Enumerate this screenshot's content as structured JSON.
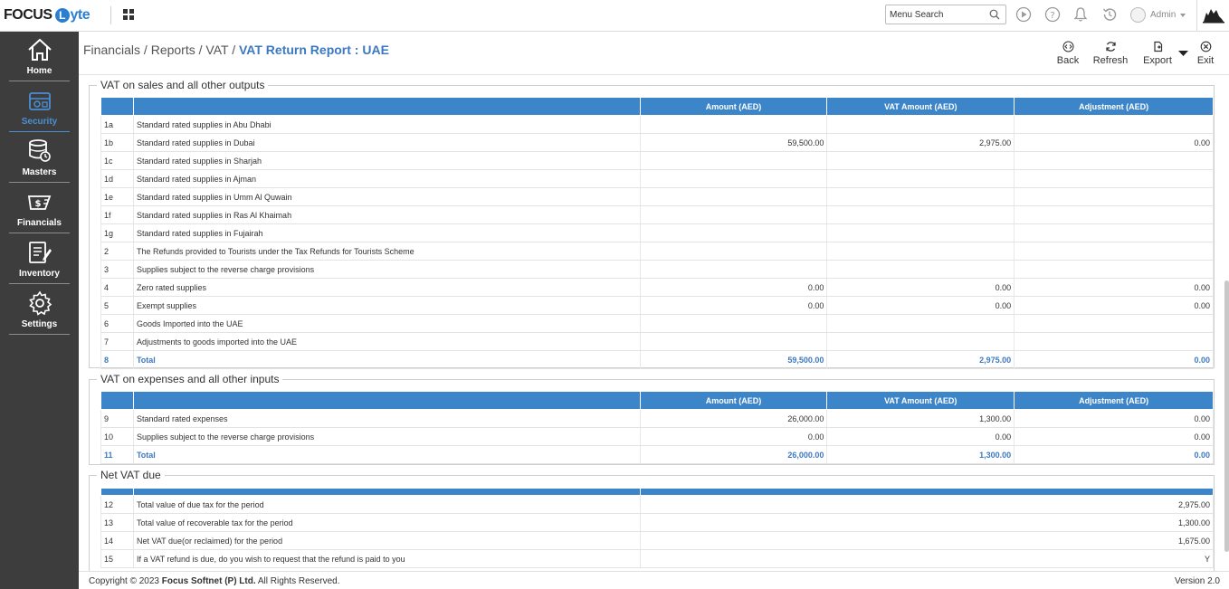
{
  "app": {
    "logo_main": "FOCUS",
    "logo_circle": "L",
    "logo_tail": "yte"
  },
  "topbar": {
    "search_placeholder": "Menu Search",
    "user": "Admin"
  },
  "sidebar": {
    "items": [
      {
        "label": "Home",
        "icon": "home-icon"
      },
      {
        "label": "Security",
        "icon": "security-icon"
      },
      {
        "label": "Masters",
        "icon": "masters-icon"
      },
      {
        "label": "Financials",
        "icon": "financials-icon"
      },
      {
        "label": "Inventory",
        "icon": "inventory-icon"
      },
      {
        "label": "Settings",
        "icon": "settings-icon"
      }
    ]
  },
  "breadcrumb": {
    "parts": [
      "Financials /",
      "Reports /",
      "VAT /"
    ],
    "current": "VAT Return Report : UAE"
  },
  "actions": {
    "back": "Back",
    "refresh": "Refresh",
    "export": "Export",
    "exit": "Exit"
  },
  "sales": {
    "title": "VAT on sales and all other outputs",
    "headers": [
      "",
      "",
      "Amount (AED)",
      "VAT Amount (AED)",
      "Adjustment (AED)"
    ],
    "rows": [
      [
        "1a",
        "Standard rated supplies in Abu Dhabi",
        "",
        "",
        ""
      ],
      [
        "1b",
        "Standard rated supplies in Dubai",
        "59,500.00",
        "2,975.00",
        "0.00"
      ],
      [
        "1c",
        "Standard rated supplies in Sharjah",
        "",
        "",
        ""
      ],
      [
        "1d",
        "Standard rated supplies in Ajman",
        "",
        "",
        ""
      ],
      [
        "1e",
        "Standard rated supplies in Umm Al Quwain",
        "",
        "",
        ""
      ],
      [
        "1f",
        "Standard rated supplies in Ras Al Khaimah",
        "",
        "",
        ""
      ],
      [
        "1g",
        "Standard rated supplies in Fujairah",
        "",
        "",
        ""
      ],
      [
        "2",
        "The Refunds provided to Tourists under the Tax Refunds for Tourists Scheme",
        "",
        "",
        ""
      ],
      [
        "3",
        "Supplies subject to the reverse charge provisions",
        "",
        "",
        ""
      ],
      [
        "4",
        "Zero rated supplies",
        "0.00",
        "0.00",
        "0.00"
      ],
      [
        "5",
        "Exempt supplies",
        "0.00",
        "0.00",
        "0.00"
      ],
      [
        "6",
        "Goods Imported into the UAE",
        "",
        "",
        ""
      ],
      [
        "7",
        "Adjustments to goods imported into the UAE",
        "",
        "",
        ""
      ]
    ],
    "total": [
      "8",
      "Total",
      "59,500.00",
      "2,975.00",
      "0.00"
    ]
  },
  "expenses": {
    "title": "VAT on expenses and all other inputs",
    "headers": [
      "",
      "",
      "Amount (AED)",
      "VAT Amount (AED)",
      "Adjustment (AED)"
    ],
    "rows": [
      [
        "9",
        "Standard rated expenses",
        "26,000.00",
        "1,300.00",
        "0.00"
      ],
      [
        "10",
        "Supplies subject to the reverse charge provisions",
        "0.00",
        "0.00",
        "0.00"
      ]
    ],
    "total": [
      "11",
      "Total",
      "26,000.00",
      "1,300.00",
      "0.00"
    ]
  },
  "net": {
    "title": "Net VAT due",
    "rows": [
      [
        "12",
        "Total value of due tax for the period",
        "2,975.00"
      ],
      [
        "13",
        "Total value of recoverable tax for the period",
        "1,300.00"
      ],
      [
        "14",
        "Net VAT due(or reclaimed) for the period",
        "1,675.00"
      ],
      [
        "15",
        "If a VAT refund is due, do you wish to request that the refund is paid to you",
        "Y"
      ]
    ]
  },
  "footer": {
    "copyright_prefix": "Copyright © 2023",
    "company": "Focus Softnet (P) Ltd.",
    "copyright_suffix": "All Rights Reserved.",
    "version": "Version 2.0"
  },
  "colors": {
    "accent": "#3d85c9",
    "sidebar": "#3d3d3d",
    "total_text": "#3d79c0"
  }
}
